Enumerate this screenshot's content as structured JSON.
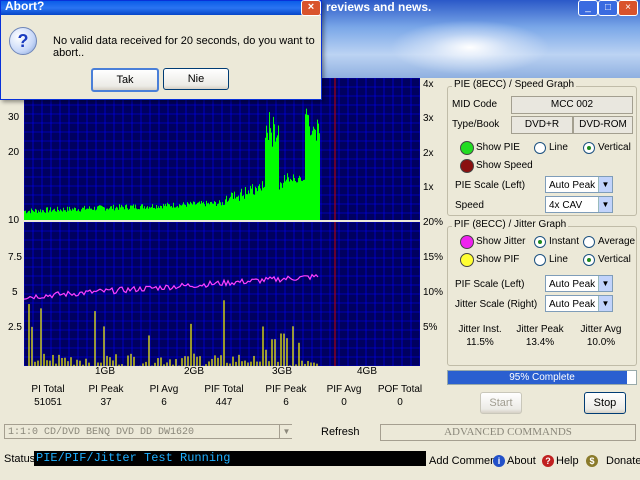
{
  "banner": {
    "title_fragment": "reviews and news."
  },
  "dialog": {
    "title": "Abort?",
    "message": "No valid data received for 20 seconds, do you want to abort..",
    "yes_label": "Tak",
    "no_label": "Nie"
  },
  "pie_graph": {
    "y_left_ticks": [
      "30",
      "20",
      "10"
    ],
    "y_right_ticks": [
      "4x",
      "3x",
      "2x",
      "1x"
    ]
  },
  "pif_graph": {
    "y_left_ticks": [
      "10",
      "7.5",
      "5",
      "2.5"
    ],
    "y_right_ticks": [
      "20%",
      "15%",
      "10%",
      "5%"
    ],
    "x_ticks": [
      "1GB",
      "2GB",
      "3GB",
      "4GB"
    ]
  },
  "stats": [
    {
      "label": "PI Total",
      "value": "51051"
    },
    {
      "label": "PI Peak",
      "value": "37"
    },
    {
      "label": "PI Avg",
      "value": "6"
    },
    {
      "label": "PIF Total",
      "value": "447"
    },
    {
      "label": "PIF Peak",
      "value": "6"
    },
    {
      "label": "PIF Avg",
      "value": "0"
    },
    {
      "label": "POF Total",
      "value": "0"
    }
  ],
  "pie_panel": {
    "title": "PIE (8ECC) / Speed Graph",
    "mid_code_label": "MID Code",
    "mid_code_value": "MCC    002",
    "type_book_label": "Type/Book",
    "type_value": "DVD+R",
    "book_value": "DVD-ROM",
    "show_pie": "Show PIE",
    "show_speed": "Show Speed",
    "line": "Line",
    "vertical": "Vertical",
    "scale_label": "PIE Scale (Left)",
    "scale_value": "Auto Peak",
    "speed_label": "Speed",
    "speed_value": "4x CAV"
  },
  "pif_panel": {
    "title": "PIF (8ECC) / Jitter Graph",
    "show_jitter": "Show Jitter",
    "show_pif": "Show PIF",
    "instant": "Instant",
    "average": "Average",
    "line": "Line",
    "vertical": "Vertical",
    "pif_scale_label": "PIF Scale (Left)",
    "pif_scale_value": "Auto Peak",
    "jitter_scale_label": "Jitter Scale (Right)",
    "jitter_scale_value": "Auto Peak",
    "jitter_inst_label": "Jitter Inst.",
    "jitter_inst_value": "11.5%",
    "jitter_peak_label": "Jitter Peak",
    "jitter_peak_value": "13.4%",
    "jitter_avg_label": "Jitter Avg",
    "jitter_avg_value": "10.0%"
  },
  "progress": {
    "text": "95% Complete",
    "fraction": 0.95
  },
  "buttons": {
    "start": "Start",
    "stop": "Stop",
    "refresh": "Refresh"
  },
  "drive": {
    "value": "1:1:0  CD/DVD BENQ    DVD DD DW1620"
  },
  "advanced": {
    "value": "ADVANCED COMMANDS"
  },
  "status": {
    "label": "Status",
    "value": "PIE/PIF/Jitter Test Running"
  },
  "footer": {
    "add_comment": "Add Comment",
    "about": "About",
    "help": "Help",
    "donate": "Donate"
  },
  "colors": {
    "plot_bg": "#000060",
    "pie_bars": "#00ff00",
    "pif_bars": "#ffff00",
    "jitter": "#ff40ff",
    "grid": "#0000ff",
    "marker": "#cc0000"
  }
}
